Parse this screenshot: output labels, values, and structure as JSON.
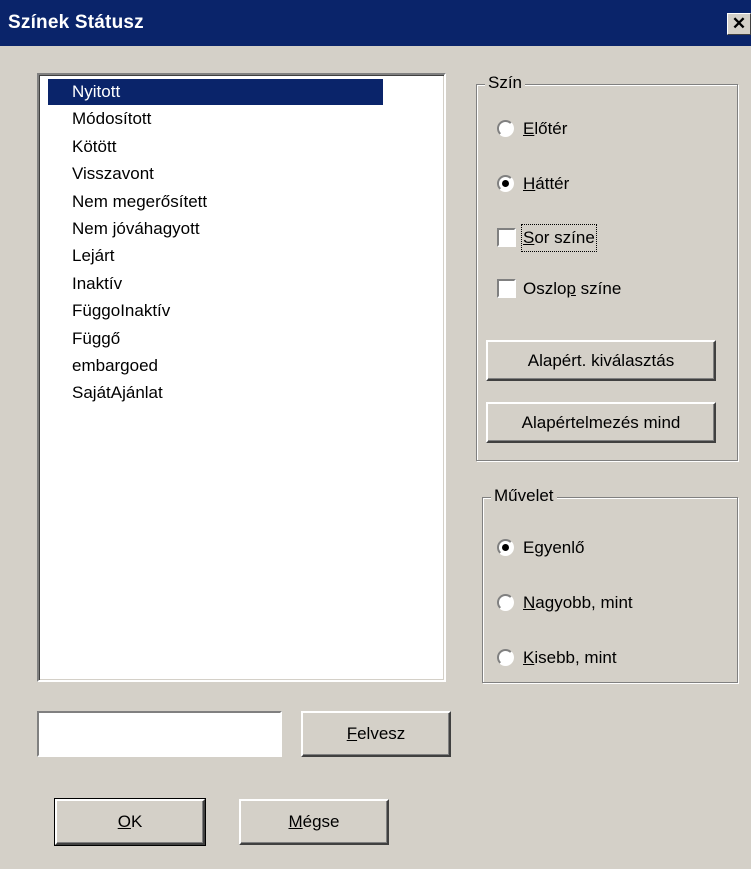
{
  "window": {
    "title": "Színek Státusz",
    "close_glyph": "✕"
  },
  "status_list": {
    "items": [
      "Nyitott",
      "Módosított",
      "Kötött",
      "Visszavont",
      "Nem megerősített",
      "Nem jóváhagyott",
      "Lejárt",
      "Inaktív",
      "FüggoInaktív",
      "Függő",
      "embargoed",
      "SajátAjánlat"
    ],
    "selected_index": 0
  },
  "color_group": {
    "title": "Szín",
    "foreground": {
      "label": "Előtér",
      "selected": false
    },
    "background": {
      "label": "Háttér",
      "selected": true
    },
    "row_color": {
      "label": "Sor színe",
      "checked": false
    },
    "column_color": {
      "label": "Oszlop színe",
      "checked": false
    },
    "select_default_button": "Alapért. kiválasztás",
    "default_all_button": "Alapértelmezés mind"
  },
  "operation_group": {
    "title": "Művelet",
    "equal": {
      "label": "Egyenlő",
      "selected": true
    },
    "greater": {
      "label": "Nagyobb, mint",
      "selected": false
    },
    "less": {
      "label": "Kisebb, mint",
      "selected": false
    }
  },
  "add_section": {
    "input_value": "",
    "add_button": "Felvesz"
  },
  "footer": {
    "ok_button": "OK",
    "cancel_button": "Mégse"
  },
  "colors": {
    "title_bar": "#0a246a",
    "face": "#d4d0c8",
    "selection": "#0a246a"
  }
}
